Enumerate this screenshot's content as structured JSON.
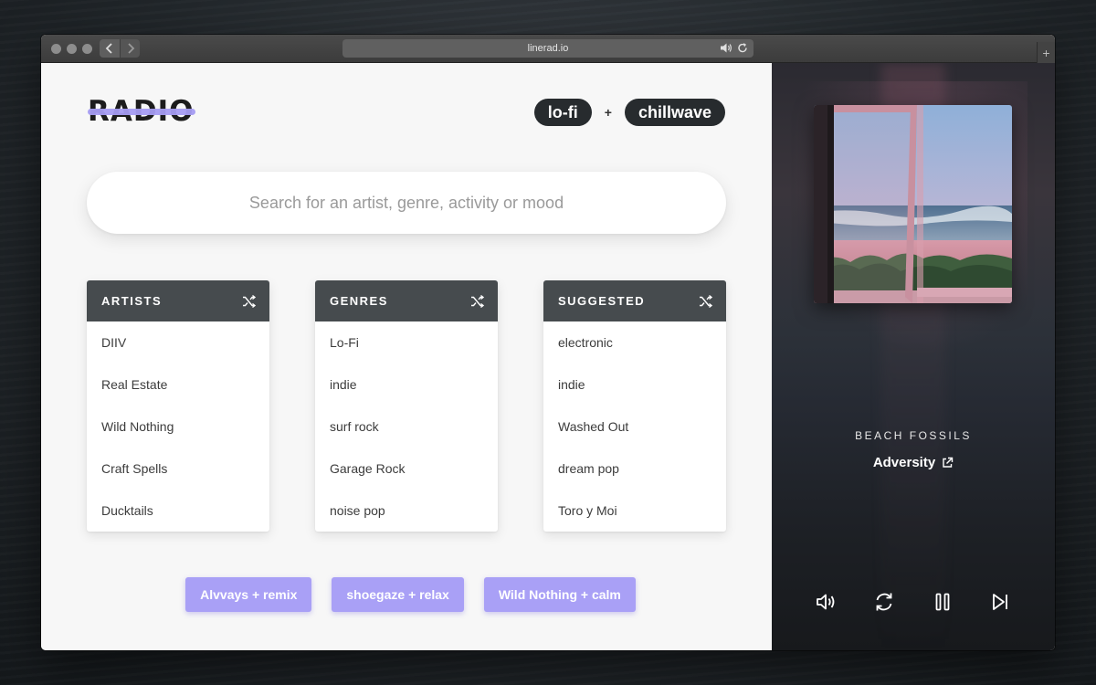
{
  "browser": {
    "url": "linerad.io",
    "back_icon": "chevron-left-icon",
    "forward_icon": "chevron-right-icon",
    "new_tab_label": "+"
  },
  "logo": {
    "text": "RADIO",
    "strike_color": "#a59cf2"
  },
  "tags": {
    "items": [
      "lo-fi",
      "chillwave"
    ],
    "joiner": "+"
  },
  "search": {
    "placeholder": "Search for an artist, genre, activity or mood",
    "value": ""
  },
  "cards": {
    "artists": {
      "title": "ARTISTS",
      "items": [
        "DIIV",
        "Real Estate",
        "Wild Nothing",
        "Craft Spells",
        "Ducktails"
      ]
    },
    "genres": {
      "title": "GENRES",
      "items": [
        "Lo-Fi",
        "indie",
        "surf rock",
        "Garage Rock",
        "noise pop"
      ]
    },
    "suggested": {
      "title": "SUGGESTED",
      "items": [
        "electronic",
        "indie",
        "Washed Out",
        "dream pop",
        "Toro y Moi"
      ]
    }
  },
  "chips": [
    "Alvvays + remix",
    "shoegaze + relax",
    "Wild Nothing + calm"
  ],
  "player": {
    "artist": "BEACH FOSSILS",
    "track": "Adversity",
    "state": "playing",
    "controls": [
      "volume-icon",
      "repeat-icon",
      "pause-icon",
      "skip-next-icon"
    ]
  },
  "colors": {
    "accent": "#a9a0f6",
    "card_header": "#464b4e",
    "pill": "#272b2e"
  }
}
